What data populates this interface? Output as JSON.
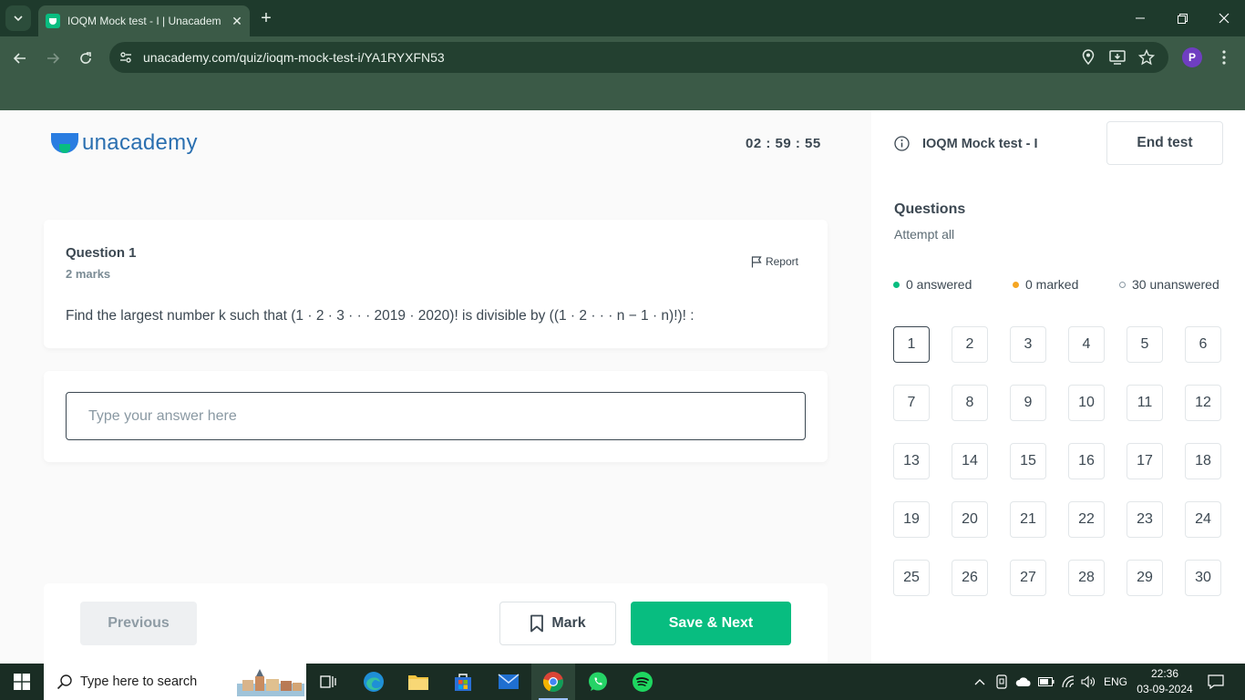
{
  "browser": {
    "tab_title": "IOQM Mock test - I | Unacademy",
    "url": "unacademy.com/quiz/ioqm-mock-test-i/YA1RYXFN53",
    "profile_initial": "P"
  },
  "header": {
    "logo_text": "unacademy",
    "timer": "02 : 59 : 55"
  },
  "question": {
    "title": "Question 1",
    "marks": "2 marks",
    "report_label": "Report",
    "text": "Find the largest number k such that (1 · 2 · 3 · · · 2019 · 2020)! is divisible by ((1 · 2 · · · n − 1 · n)!)! :"
  },
  "answer": {
    "placeholder": "Type your answer here",
    "value": ""
  },
  "footer": {
    "previous_label": "Previous",
    "mark_label": "Mark",
    "save_next_label": "Save & Next"
  },
  "side_panel": {
    "test_name": "IOQM Mock test - I",
    "end_test_label": "End test",
    "questions_heading": "Questions",
    "questions_sub": "Attempt all",
    "legend": {
      "answered": "0 answered",
      "marked": "0 marked",
      "unanswered": "30 unanswered"
    },
    "current_question": 1,
    "question_numbers": [
      "1",
      "2",
      "3",
      "4",
      "5",
      "6",
      "7",
      "8",
      "9",
      "10",
      "11",
      "12",
      "13",
      "14",
      "15",
      "16",
      "17",
      "18",
      "19",
      "20",
      "21",
      "22",
      "23",
      "24",
      "25",
      "26",
      "27",
      "28",
      "29",
      "30"
    ]
  },
  "colors": {
    "accent_green": "#08bd80",
    "marked_orange": "#f5a623",
    "text_dark": "#3c4852",
    "logo_blue": "#2a6fb0"
  },
  "taskbar": {
    "search_placeholder": "Type here to search",
    "language": "ENG",
    "time": "22:36",
    "date": "03-09-2024"
  }
}
